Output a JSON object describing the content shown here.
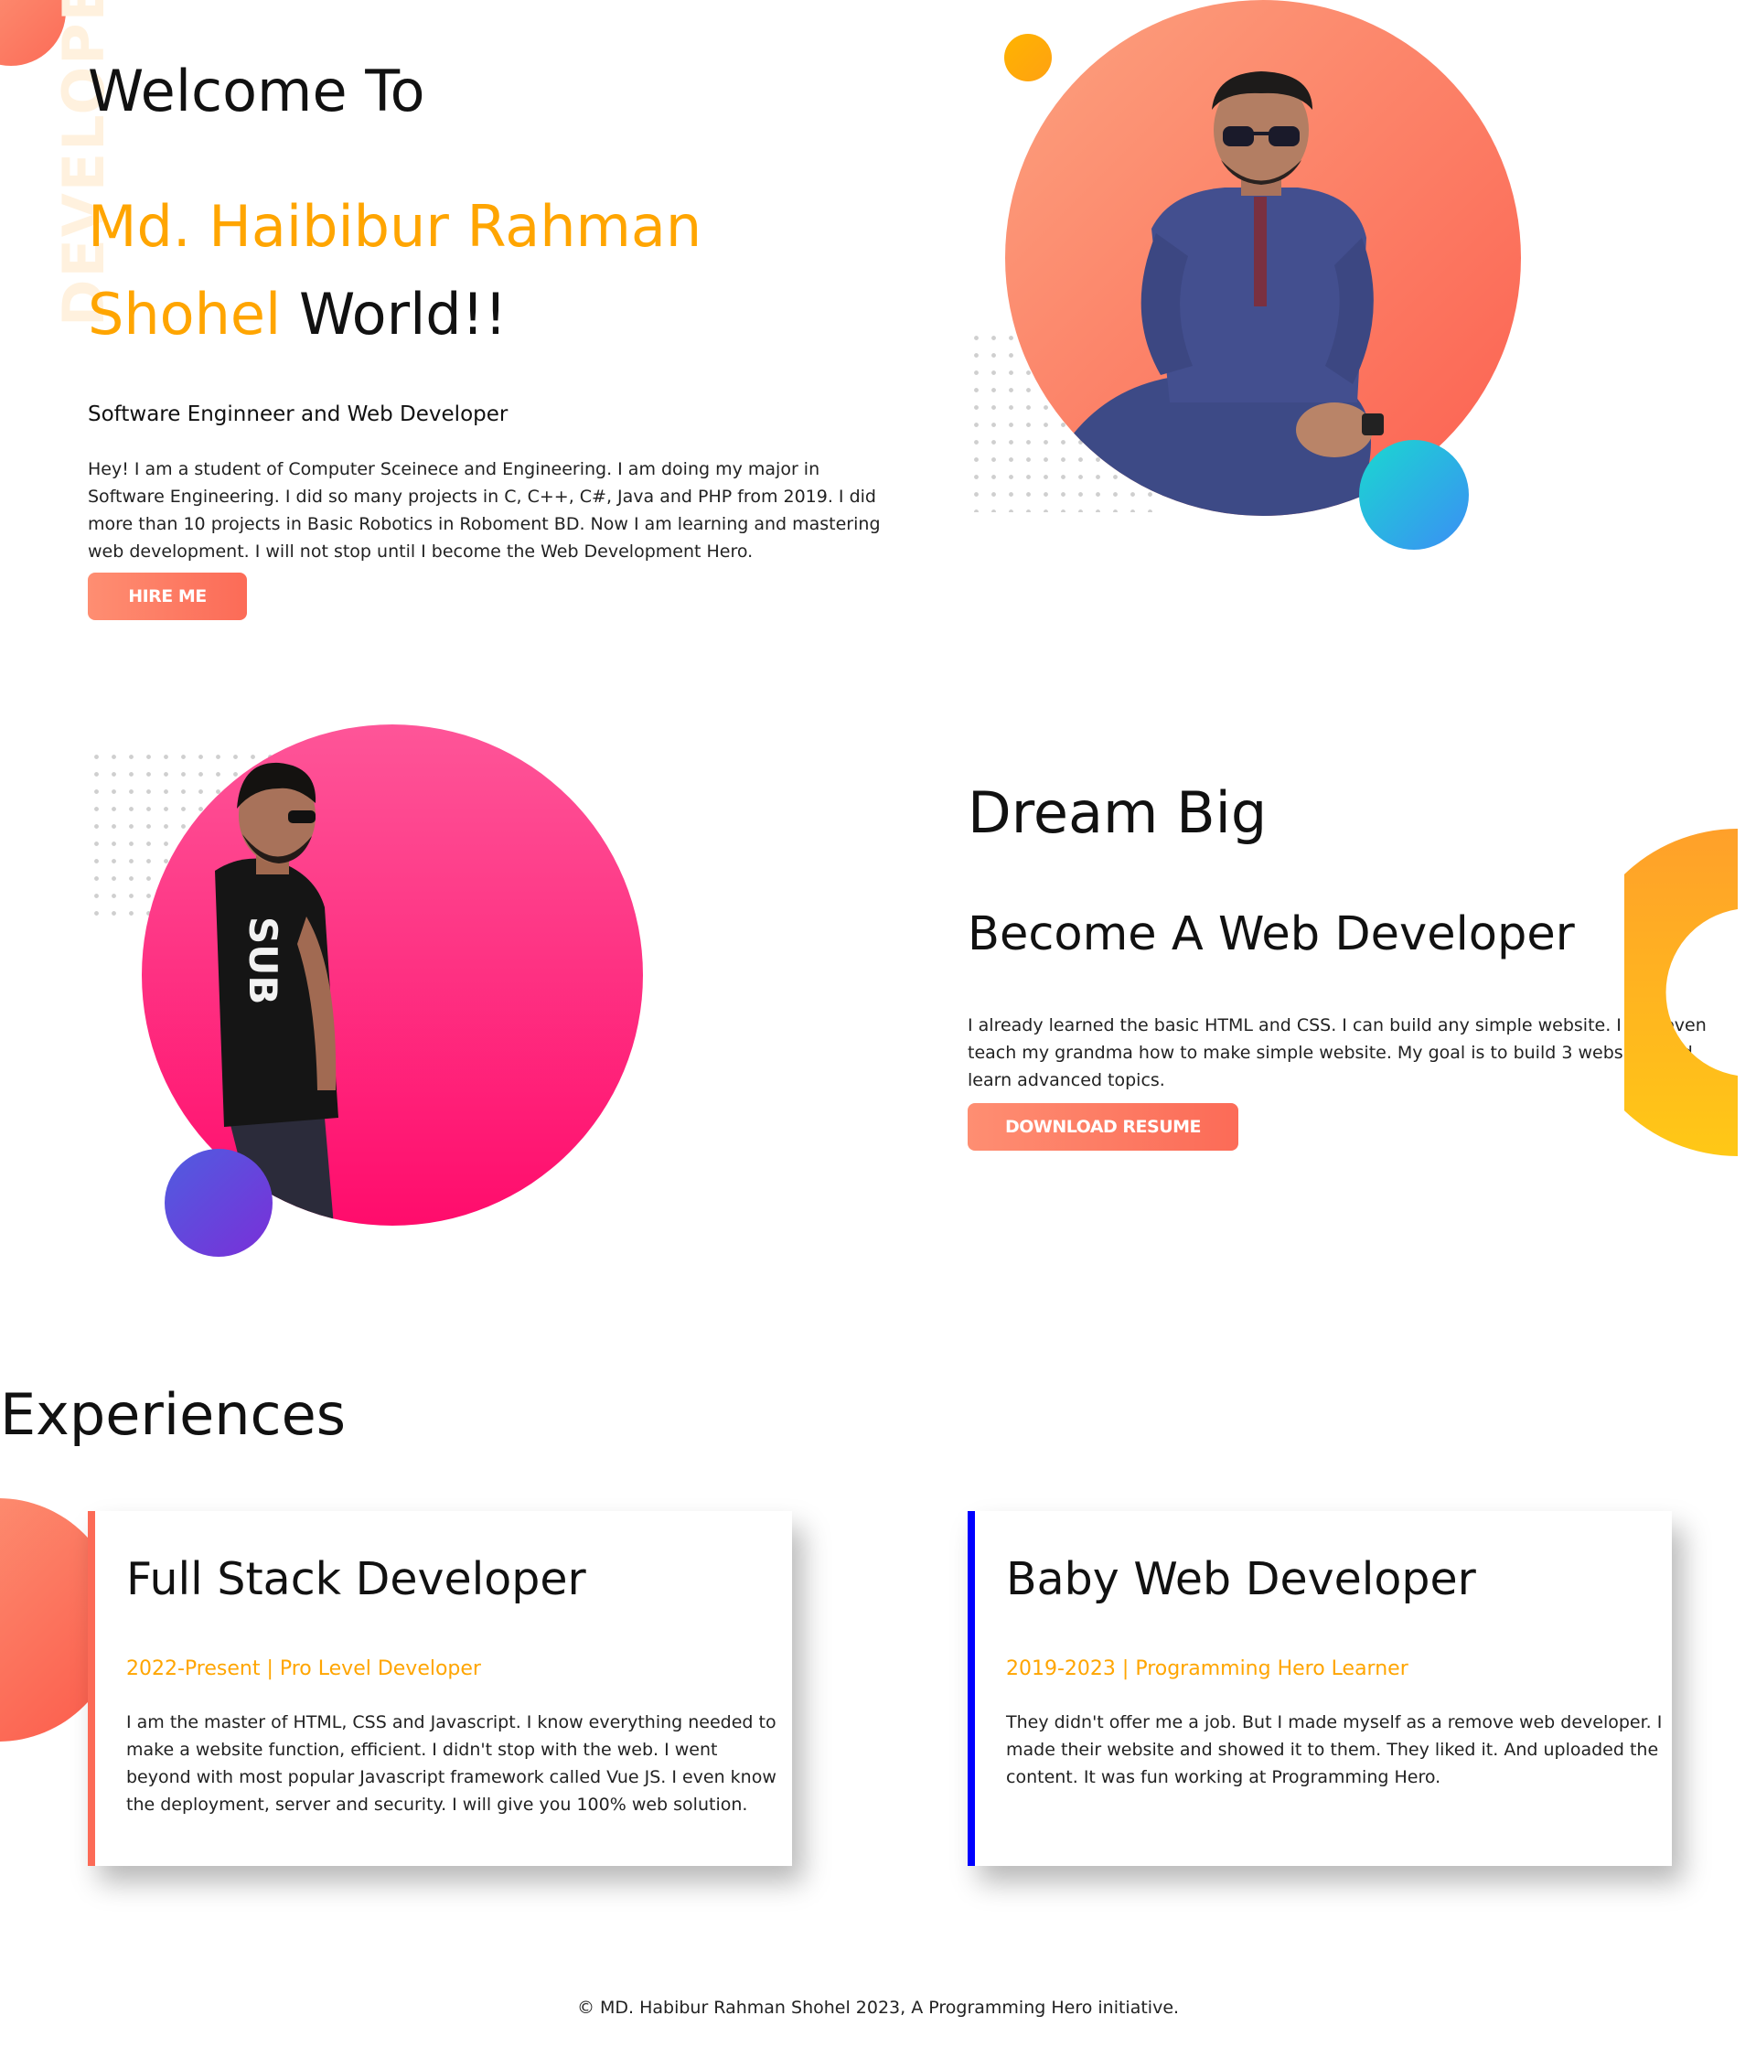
{
  "hero": {
    "vertical_word": "DEVELOPER",
    "welcome": "Welcome To",
    "name_highlight": "Md. Haibibur Rahman Shohel",
    "name_suffix": "World!!",
    "tagline": "Software Enginneer and Web Developer",
    "description": "Hey! I am a student of Computer Sceinece and Engineering. I am doing my major in Software Engineering. I did so many projects in C, C++, C#, Java and PHP from 2019. I did more than 10 projects in Basic Robotics in Roboment BD. Now I am learning and mastering web development. I will not stop until I become the Web Development Hero.",
    "cta_label": "HIRE ME"
  },
  "dream": {
    "title": "Dream Big",
    "subtitle": "Become A Web Developer",
    "description": "I already learned the basic HTML and CSS. I can build any simple website. I can even teach my grandma how to make simple website. My goal is to build 3 websites and learn advanced topics.",
    "cta_label": "DOWNLOAD RESUME"
  },
  "experiences": {
    "title": "Experiences",
    "items": [
      {
        "title": "Full Stack Developer",
        "meta": "2022-Present | Pro Level Developer",
        "description": "I am the master of HTML, CSS and Javascript. I know everything needed to make a website function, efficient. I didn't stop with the web. I went beyond with most popular Javascript framework called Vue JS. I even know the deployment, server and security. I will give you 100% web solution.",
        "accent_color": "#fc6b57"
      },
      {
        "title": "Baby Web Developer",
        "meta": "2019-2023 | Programming Hero Learner",
        "description": "They didn't offer me a job. But I made myself as a remove web developer. I made their website and showed it to them. They liked it. And uploaded the content. It was fun working at Programming Hero.",
        "accent_color": "#0000ff"
      }
    ]
  },
  "footer": {
    "text": "© MD. Habibur Rahman Shohel 2023, A Programming Hero initiative."
  },
  "theme": {
    "accent": "#ffa500",
    "button_gradient": [
      "#fe8e72",
      "#fc6b57"
    ],
    "hero_circle_gradient": [
      "#fd9a7a",
      "#fc6b57"
    ],
    "dream_circle_gradient": [
      "#fe5598",
      "#ff0c6c"
    ]
  }
}
